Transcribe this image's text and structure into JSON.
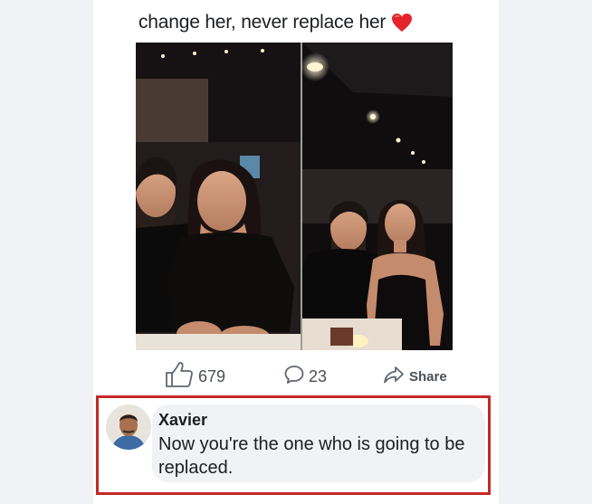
{
  "post": {
    "caption": "change her, never replace her",
    "caption_emoji": "red-heart-icon",
    "photo_description_icon": "photo"
  },
  "reactions": {
    "likes": "679",
    "comments": "23",
    "share_label": "Share"
  },
  "comment": {
    "author": "Xavier",
    "text": "Now you're the one who is going to be replaced.",
    "highlight_color": "#c62828"
  }
}
